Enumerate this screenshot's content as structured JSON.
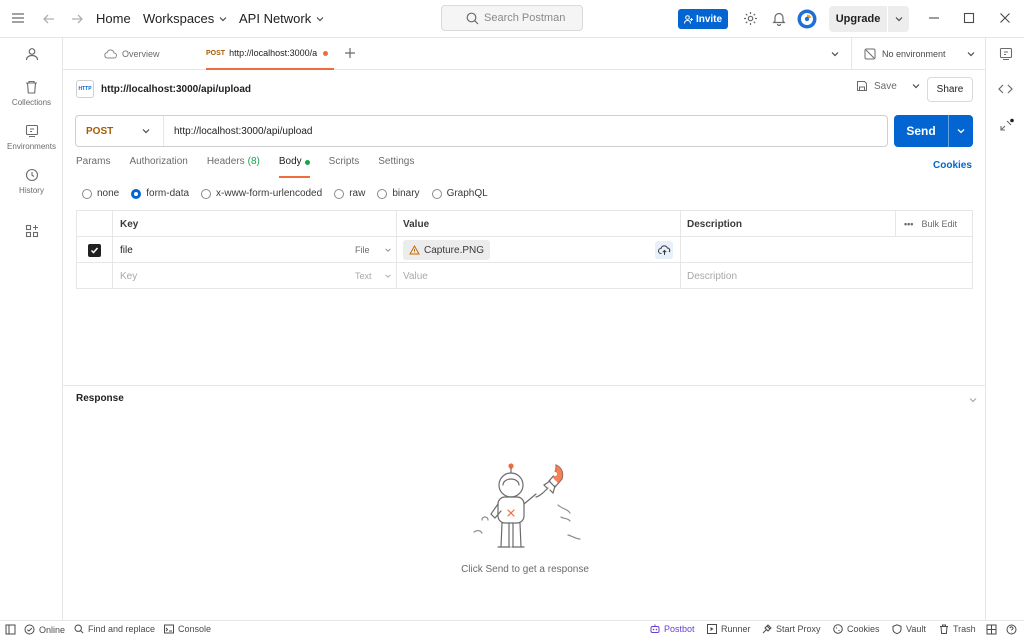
{
  "topbar": {
    "home": "Home",
    "workspaces": "Workspaces",
    "api_network": "API Network",
    "search_placeholder": "Search Postman",
    "invite": "Invite",
    "upgrade": "Upgrade"
  },
  "sidebar": {
    "items": [
      {
        "label": "",
        "icon": "user-icon"
      },
      {
        "label": "Collections",
        "icon": "trash-can-icon"
      },
      {
        "label": "Environments",
        "icon": "environment-icon"
      },
      {
        "label": "History",
        "icon": "history-icon"
      },
      {
        "label": "",
        "icon": "grid-plus-icon"
      }
    ]
  },
  "tabs": {
    "overview": "Overview",
    "request_method": "POST",
    "request_url": "http://localhost:3000/a",
    "environment": "No environment"
  },
  "request": {
    "title": "http://localhost:3000/api/upload",
    "http_badge": "HTTP",
    "save": "Save",
    "share": "Share",
    "method": "POST",
    "url": "http://localhost:3000/api/upload",
    "send": "Send",
    "cookies": "Cookies",
    "tabs": [
      {
        "label": "Params",
        "count": ""
      },
      {
        "label": "Authorization",
        "count": ""
      },
      {
        "label": "Headers",
        "count": "(8)"
      },
      {
        "label": "Body",
        "count": ""
      },
      {
        "label": "Scripts",
        "count": ""
      },
      {
        "label": "Settings",
        "count": ""
      }
    ],
    "body_types": [
      {
        "label": "none",
        "selected": false
      },
      {
        "label": "form-data",
        "selected": true
      },
      {
        "label": "x-www-form-urlencoded",
        "selected": false
      },
      {
        "label": "raw",
        "selected": false
      },
      {
        "label": "binary",
        "selected": false
      },
      {
        "label": "GraphQL",
        "selected": false
      }
    ]
  },
  "table": {
    "headers": {
      "key": "Key",
      "value": "Value",
      "description": "Description",
      "bulk_edit": "Bulk Edit"
    },
    "rows": [
      {
        "checked": true,
        "key": "file",
        "type": "File",
        "value": "Capture.PNG",
        "description": ""
      },
      {
        "checked": false,
        "key": "Key",
        "type": "Text",
        "value": "Value",
        "description": "Description"
      }
    ]
  },
  "response": {
    "title": "Response",
    "empty_message": "Click Send to get a response"
  },
  "statusbar": {
    "online": "Online",
    "find_replace": "Find and replace",
    "console": "Console",
    "postbot": "Postbot",
    "runner": "Runner",
    "start_proxy": "Start Proxy",
    "cookies": "Cookies",
    "vault": "Vault",
    "trash": "Trash"
  },
  "colors": {
    "accent_blue": "#0265d2",
    "tab_orange": "#f26b3a",
    "post_method": "#a65b00",
    "dot_green": "#14a44d",
    "postbot_purple": "#6b3fd4"
  }
}
